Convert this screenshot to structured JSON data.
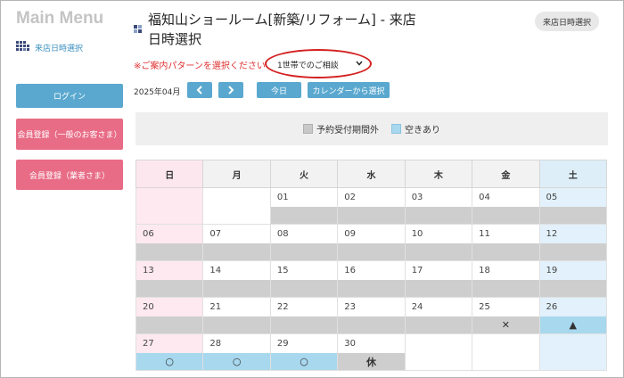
{
  "sidebar": {
    "title": "Main Menu",
    "nav_link": "来店日時選択",
    "login_label": "ログイン",
    "member_general_label": "会員登録（一般のお客さま）",
    "member_business_label": "会員登録（業者さま）"
  },
  "header": {
    "title_line1": "福知山ショールーム[新築/リフォーム] - 来店",
    "title_line2": "日時選択",
    "badge": "来店日時選択"
  },
  "pattern": {
    "label": "※ご案内パターンを選択ください",
    "selected": "1世帯でのご相談"
  },
  "nav": {
    "month": "2025年04月",
    "prev": "<",
    "next": ">",
    "today": "今日",
    "from_calendar": "カレンダーから選択"
  },
  "legend": {
    "out_of_period": "予約受付期間外",
    "available": "空きあり"
  },
  "calendar": {
    "weekdays": [
      "日",
      "月",
      "火",
      "水",
      "木",
      "金",
      "土"
    ],
    "weeks": [
      [
        {
          "day": "",
          "status": "none",
          "mark": ""
        },
        {
          "day": "",
          "status": "none",
          "mark": ""
        },
        {
          "day": "01",
          "status": "out",
          "mark": ""
        },
        {
          "day": "02",
          "status": "out",
          "mark": ""
        },
        {
          "day": "03",
          "status": "out",
          "mark": ""
        },
        {
          "day": "04",
          "status": "out",
          "mark": ""
        },
        {
          "day": "05",
          "status": "out",
          "mark": ""
        }
      ],
      [
        {
          "day": "06",
          "status": "out",
          "mark": ""
        },
        {
          "day": "07",
          "status": "out",
          "mark": ""
        },
        {
          "day": "08",
          "status": "out",
          "mark": ""
        },
        {
          "day": "09",
          "status": "out",
          "mark": ""
        },
        {
          "day": "10",
          "status": "out",
          "mark": ""
        },
        {
          "day": "11",
          "status": "out",
          "mark": ""
        },
        {
          "day": "12",
          "status": "out",
          "mark": ""
        }
      ],
      [
        {
          "day": "13",
          "status": "out",
          "mark": ""
        },
        {
          "day": "14",
          "status": "out",
          "mark": ""
        },
        {
          "day": "15",
          "status": "out",
          "mark": ""
        },
        {
          "day": "16",
          "status": "out",
          "mark": ""
        },
        {
          "day": "17",
          "status": "out",
          "mark": ""
        },
        {
          "day": "18",
          "status": "out",
          "mark": ""
        },
        {
          "day": "19",
          "status": "out",
          "mark": ""
        }
      ],
      [
        {
          "day": "20",
          "status": "out",
          "mark": ""
        },
        {
          "day": "21",
          "status": "out",
          "mark": ""
        },
        {
          "day": "22",
          "status": "out",
          "mark": ""
        },
        {
          "day": "23",
          "status": "out",
          "mark": ""
        },
        {
          "day": "24",
          "status": "out",
          "mark": ""
        },
        {
          "day": "25",
          "status": "out",
          "mark": "✕"
        },
        {
          "day": "26",
          "status": "open",
          "mark": "▲"
        }
      ],
      [
        {
          "day": "27",
          "status": "open",
          "mark": "○"
        },
        {
          "day": "28",
          "status": "open",
          "mark": "○"
        },
        {
          "day": "29",
          "status": "open",
          "mark": "○"
        },
        {
          "day": "30",
          "status": "out",
          "mark": "休"
        },
        {
          "day": "",
          "status": "none",
          "mark": ""
        },
        {
          "day": "",
          "status": "none",
          "mark": ""
        },
        {
          "day": "",
          "status": "none",
          "mark": ""
        }
      ]
    ]
  },
  "colors": {
    "accent_blue": "#5aa8cf",
    "accent_pink": "#e86c86",
    "out_of_period": "#cecece",
    "available": "#a8d8ee",
    "highlight_ellipse": "#d42020"
  }
}
